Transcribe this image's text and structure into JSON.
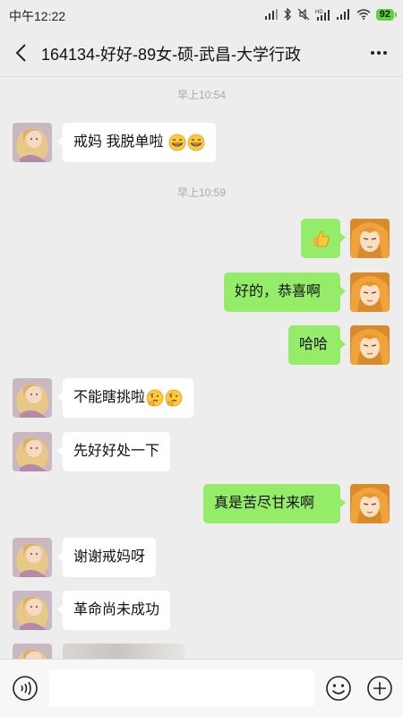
{
  "status_bar": {
    "time": "中午12:22",
    "battery": "92"
  },
  "header": {
    "title": "164134-好好-89女-硕-武昌-大学行政"
  },
  "timestamps": [
    "早上10:54",
    "早上10:59"
  ],
  "messages": [
    {
      "side": "in",
      "text": "戒妈 我脱单啦",
      "emoji": [
        "grin-icon",
        "grin-icon"
      ]
    },
    {
      "side": "out",
      "text": "",
      "emoji": [
        "thumbs-up-icon"
      ]
    },
    {
      "side": "out",
      "text": "好的，恭喜啊"
    },
    {
      "side": "out",
      "text": "哈哈"
    },
    {
      "side": "in",
      "text": "不能瞎挑啦",
      "emoji": [
        "thinking-icon",
        "thinking-icon"
      ]
    },
    {
      "side": "in",
      "text": "先好好处一下"
    },
    {
      "side": "out",
      "text": "真是苦尽甘来啊"
    },
    {
      "side": "in",
      "text": "谢谢戒妈呀"
    },
    {
      "side": "in",
      "text": "革命尚未成功"
    },
    {
      "side": "in",
      "text": "",
      "kind": "image"
    }
  ],
  "input": {
    "value": "",
    "placeholder": ""
  },
  "icons": {
    "back": "back-chevron-icon",
    "more": "more-dots-icon",
    "voice": "voice-input-icon",
    "emoji": "emoji-smiley-icon",
    "add": "plus-add-icon"
  },
  "colors": {
    "outgoing_bubble": "#95ec69",
    "incoming_bubble": "#ffffff",
    "background": "#ededed"
  }
}
